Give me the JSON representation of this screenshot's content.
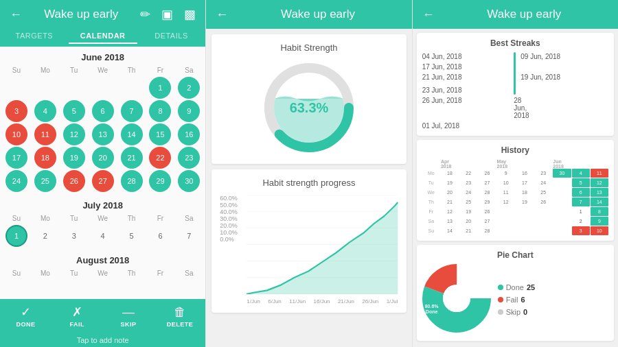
{
  "panel1": {
    "title": "Wake up early",
    "tabs": [
      "TARGETS",
      "CALENDAR",
      "DETAILS"
    ],
    "active_tab": "CALENDAR",
    "months": [
      {
        "name": "June 2018",
        "days_of_week": [
          "Su",
          "Mo",
          "Tu",
          "We",
          "Th",
          "Fr",
          "Sa"
        ],
        "offset": 5,
        "days": [
          {
            "n": "1",
            "t": "done"
          },
          {
            "n": "2",
            "t": "done"
          },
          {
            "n": "3",
            "t": "fail"
          },
          {
            "n": "4",
            "t": "done"
          },
          {
            "n": "5",
            "t": "done"
          },
          {
            "n": "6",
            "t": "done"
          },
          {
            "n": "7",
            "t": "done"
          },
          {
            "n": "8",
            "t": "done"
          },
          {
            "n": "9",
            "t": "done"
          },
          {
            "n": "10",
            "t": "fail"
          },
          {
            "n": "11",
            "t": "fail"
          },
          {
            "n": "12",
            "t": "done"
          },
          {
            "n": "13",
            "t": "done"
          },
          {
            "n": "14",
            "t": "done"
          },
          {
            "n": "15",
            "t": "done"
          },
          {
            "n": "16",
            "t": "done"
          },
          {
            "n": "17",
            "t": "done"
          },
          {
            "n": "18",
            "t": "fail"
          },
          {
            "n": "19",
            "t": "done"
          },
          {
            "n": "20",
            "t": "done"
          },
          {
            "n": "21",
            "t": "done"
          },
          {
            "n": "22",
            "t": "fail"
          },
          {
            "n": "23",
            "t": "done"
          },
          {
            "n": "24",
            "t": "done"
          },
          {
            "n": "25",
            "t": "done"
          },
          {
            "n": "26",
            "t": "fail"
          },
          {
            "n": "27",
            "t": "fail"
          },
          {
            "n": "28",
            "t": "done"
          },
          {
            "n": "29",
            "t": "done"
          },
          {
            "n": "30",
            "t": "done"
          }
        ]
      },
      {
        "name": "July 2018",
        "days_of_week": [
          "Su",
          "Mo",
          "Tu",
          "We",
          "Th",
          "Fr",
          "Sa"
        ],
        "offset": 0,
        "days": [
          {
            "n": "1",
            "t": "today"
          },
          {
            "n": "2",
            "t": "plain"
          },
          {
            "n": "3",
            "t": "plain"
          },
          {
            "n": "4",
            "t": "plain"
          },
          {
            "n": "5",
            "t": "plain"
          },
          {
            "n": "6",
            "t": "plain"
          },
          {
            "n": "7",
            "t": "plain"
          }
        ]
      },
      {
        "name": "August 2018",
        "days_of_week": [
          "Su",
          "Mo",
          "Tu",
          "We",
          "Th",
          "Fr",
          "Sa"
        ],
        "offset": 3,
        "days": []
      }
    ],
    "action_buttons": [
      {
        "label": "DONE",
        "icon": "✓"
      },
      {
        "label": "FAIL",
        "icon": "✗"
      },
      {
        "label": "SKIP",
        "icon": "—"
      },
      {
        "label": "DELETE",
        "icon": "🗑"
      }
    ],
    "tap_note": "Tap to add note"
  },
  "panel2": {
    "title": "Wake up early",
    "gauge": {
      "title": "Habit Strength",
      "value": 63.3,
      "display": "63.3%",
      "color": "#2ec4a5"
    },
    "progress_chart": {
      "title": "Habit strength progress",
      "x_labels": [
        "1/Jun",
        "6/Jun",
        "11/Jun",
        "16/Jun",
        "21/Jun",
        "26/Jun",
        "1/Jul"
      ],
      "y_labels": [
        "60.0%",
        "50.0%",
        "40.0%",
        "30.0%",
        "20.0%",
        "10.0%",
        "0.0%"
      ],
      "color": "#2ec4a5"
    }
  },
  "panel3": {
    "title": "Wake up early",
    "best_streaks": {
      "title": "Best Streaks",
      "left": [
        "04 Jun, 2018",
        "17 Jun, 2018",
        "19 Jun, 2018",
        "23 Jun, 2018",
        "28 Jun, 2018"
      ],
      "right": [
        "09 Jun, 2018",
        "21 Jun, 2018",
        "",
        "26 Jun, 2018",
        "01 Jul, 2018"
      ]
    },
    "history": {
      "title": "History"
    },
    "pie_chart": {
      "title": "Pie Chart",
      "segments": [
        {
          "label": "Done",
          "value": 25,
          "pct": 80.6,
          "color": "#2ec4a5"
        },
        {
          "label": "Fail",
          "value": 6,
          "pct": 19.4,
          "color": "#e74c3c"
        },
        {
          "label": "Skip",
          "value": 0,
          "pct": 0,
          "color": "#ccc"
        }
      ]
    }
  }
}
